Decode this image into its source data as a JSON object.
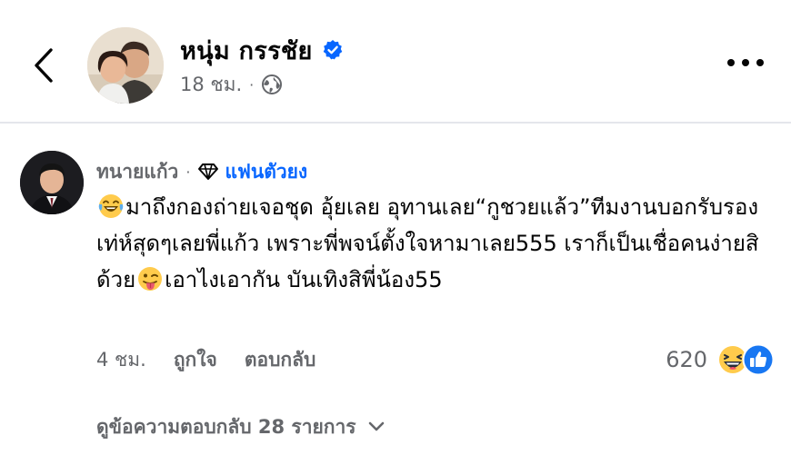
{
  "post": {
    "author": "หนุ่ม กรรชัย",
    "time": "18 ชม.",
    "separator": "·"
  },
  "comment": {
    "author": "ทนายแก้ว",
    "separator": "·",
    "badge": "แฟนตัวยง",
    "text_1": "มาถึงกองถ่ายเจอชุด อุ้ยเลย อุทานเลย“กูชวยแล้ว”ทีมงานบอกรับรองเท่ห์สุดๆเลยพี่แก้ว เพราะพี่พจน์ตั้งใจหามาเลย555 เราก็เป็นเชื่อคนง่ายสิด้วย",
    "text_2": "เอาไงเอากัน บันเทิงสิพี่น้อง55",
    "time": "4 ชม.",
    "like_label": "ถูกใจ",
    "reply_label": "ตอบกลับ",
    "reaction_count": "620",
    "view_replies": "ดูข้อความตอบกลับ 28 รายการ"
  },
  "colors": {
    "accent": "#0866ff",
    "secondary_text": "#65676b",
    "divider": "#e4e6eb"
  },
  "icons": [
    "back-chevron-icon",
    "verified-badge-icon",
    "globe-icon",
    "more-dots-icon",
    "diamond-icon",
    "laughing-emoji-icon",
    "tongue-emoji-icon",
    "haha-reaction-icon",
    "like-reaction-icon",
    "chevron-down-icon"
  ]
}
